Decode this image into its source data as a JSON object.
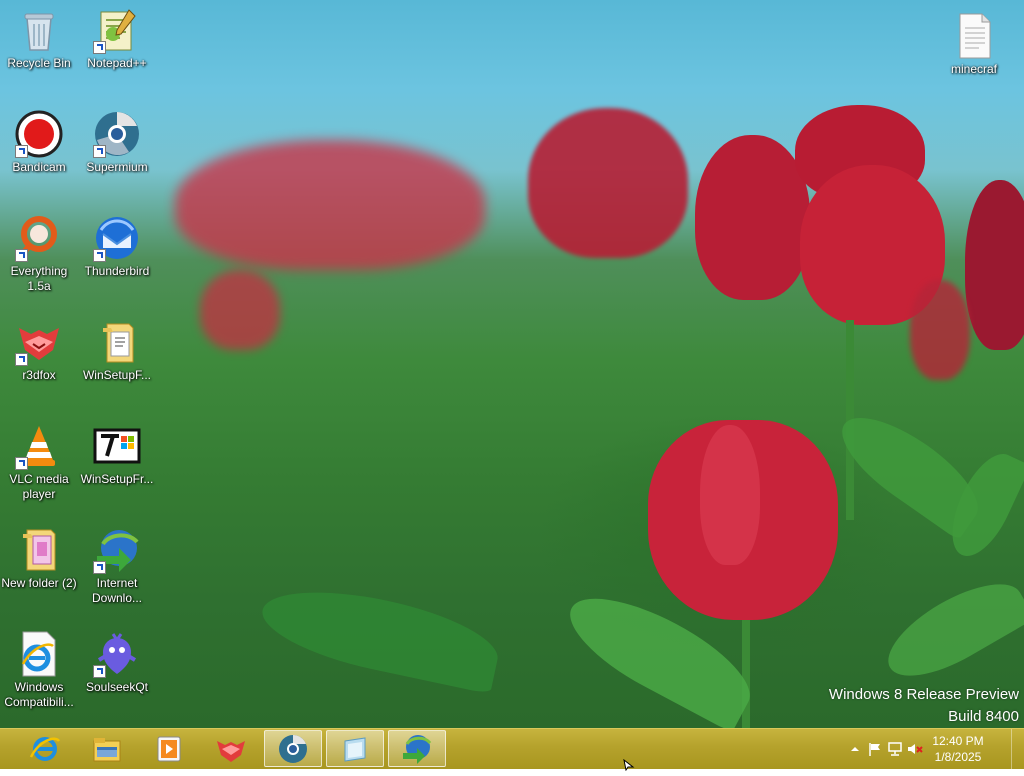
{
  "desktop": {
    "icons": [
      {
        "label": "Recycle Bin",
        "icon": "recycle-bin-icon"
      },
      {
        "label": "Notepad++",
        "icon": "notepad-plus-plus-icon"
      },
      {
        "label": "minecraf",
        "icon": "text-file-icon"
      },
      {
        "label": "Bandicam",
        "icon": "bandicam-icon"
      },
      {
        "label": "Supermium",
        "icon": "supermium-icon"
      },
      {
        "label": "Everything 1.5a",
        "icon": "everything-search-icon"
      },
      {
        "label": "Thunderbird",
        "icon": "thunderbird-icon"
      },
      {
        "label": "r3dfox",
        "icon": "r3dfox-icon"
      },
      {
        "label": "WinSetupF...",
        "icon": "folder-icon"
      },
      {
        "label": "VLC media player",
        "icon": "vlc-icon"
      },
      {
        "label": "WinSetupFr...",
        "icon": "win7-setup-icon"
      },
      {
        "label": "New folder (2)",
        "icon": "folder-icon"
      },
      {
        "label": "Internet Downlo...",
        "icon": "internet-download-manager-icon"
      },
      {
        "label": "Windows Compatibili...",
        "icon": "internet-explorer-file-icon"
      },
      {
        "label": "SoulseekQt",
        "icon": "soulseek-icon"
      }
    ],
    "watermark": {
      "line1": "Windows 8 Release Preview",
      "line2": "Build 8400"
    }
  },
  "taskbar": {
    "pinned": [
      {
        "name": "Internet Explorer",
        "icon": "internet-explorer-icon",
        "active": false
      },
      {
        "name": "File Explorer",
        "icon": "file-explorer-icon",
        "active": false
      },
      {
        "name": "Media Player",
        "icon": "media-player-icon",
        "active": false
      },
      {
        "name": "r3dfox",
        "icon": "r3dfox-icon",
        "active": false
      },
      {
        "name": "Supermium",
        "icon": "supermium-icon",
        "active": true
      },
      {
        "name": "Window",
        "icon": "window-icon",
        "active": true
      },
      {
        "name": "Internet Download Manager",
        "icon": "internet-download-manager-icon",
        "active": true
      }
    ],
    "tray": {
      "icons": [
        "chevron-up-icon",
        "flag-icon",
        "network-icon",
        "speaker-muted-icon"
      ],
      "time": "12:40 PM",
      "date": "1/8/2025"
    }
  },
  "colors": {
    "taskbar": "#b5a22c",
    "sky": "#6cc4e0",
    "tulip": "#c8233a",
    "leaf": "#3f9a3c"
  }
}
